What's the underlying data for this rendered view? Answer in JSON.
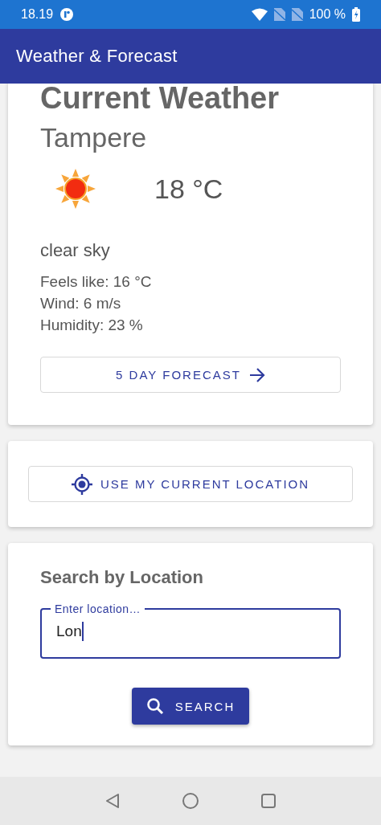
{
  "status_bar": {
    "time": "18.19",
    "battery": "100 %"
  },
  "app_bar": {
    "title": "Weather & Forecast"
  },
  "current_weather": {
    "heading": "Current Weather",
    "city": "Tampere",
    "temperature": "18 °C",
    "description": "clear sky",
    "details": [
      "Feels like: 16 °C",
      "Wind: 6 m/s",
      "Humidity: 23 %"
    ],
    "forecast_button": "5 DAY FORECAST"
  },
  "location_button": "USE MY CURRENT LOCATION",
  "search": {
    "heading": "Search by Location",
    "label": "Enter location…",
    "value": "Lon",
    "focused": true,
    "button": "SEARCH"
  }
}
